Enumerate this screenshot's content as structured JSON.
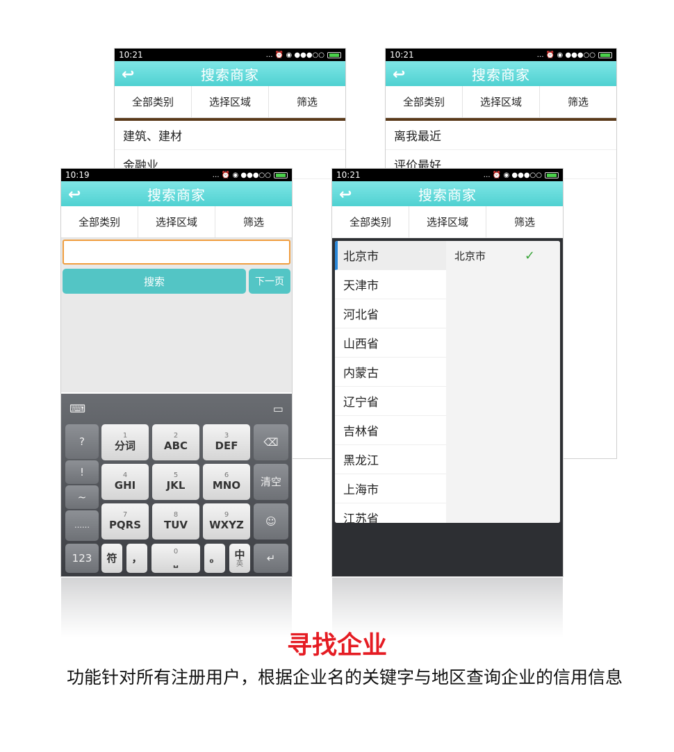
{
  "screens": [
    {
      "time": "10:21",
      "title": "搜索商家",
      "tabs": [
        "全部类别",
        "选择区域",
        "筛选"
      ],
      "items": [
        "建筑、建材",
        "金融业"
      ]
    },
    {
      "time": "10:21",
      "title": "搜索商家",
      "tabs": [
        "全部类别",
        "选择区域",
        "筛选"
      ],
      "items": [
        "离我最近",
        "评价最好"
      ]
    },
    {
      "time": "10:19",
      "title": "搜索商家",
      "tabs": [
        "全部类别",
        "选择区域",
        "筛选"
      ],
      "search_value": "",
      "search_button": "搜索",
      "next_button": "下一页"
    },
    {
      "time": "10:21",
      "title": "搜索商家",
      "tabs": [
        "全部类别",
        "选择区域",
        "筛选"
      ],
      "provinces": [
        "北京市",
        "天津市",
        "河北省",
        "山西省",
        "内蒙古",
        "辽宁省",
        "吉林省",
        "黑龙江",
        "上海市",
        "江苏省"
      ],
      "city_selected": "北京市",
      "check_icon": "✓"
    }
  ],
  "keyboard": {
    "left_keys": [
      "?",
      "!",
      "~",
      "……"
    ],
    "rows": [
      [
        {
          "num": "1",
          "lbl": "分词"
        },
        {
          "num": "2",
          "lbl": "ABC"
        },
        {
          "num": "3",
          "lbl": "DEF"
        }
      ],
      [
        {
          "num": "4",
          "lbl": "GHI"
        },
        {
          "num": "5",
          "lbl": "JKL"
        },
        {
          "num": "6",
          "lbl": "MNO"
        }
      ],
      [
        {
          "num": "7",
          "lbl": "PQRS"
        },
        {
          "num": "8",
          "lbl": "TUV"
        },
        {
          "num": "9",
          "lbl": "WXYZ"
        }
      ]
    ],
    "clear_label": "清空",
    "num_switch": "123",
    "symbol_label": "符",
    "comma_label": "，",
    "space_num": "0",
    "period_label": "。",
    "lang_label": "中",
    "lang_sub": "英"
  },
  "heading": "寻找企业",
  "description": "功能针对所有注册用户，根据企业名的关键字与地区查询企业的信用信息",
  "colors": {
    "accent": "#4fd1d1",
    "heading": "#e51c23",
    "search_btn": "#53c5c5",
    "input_border": "#f09d3e"
  }
}
